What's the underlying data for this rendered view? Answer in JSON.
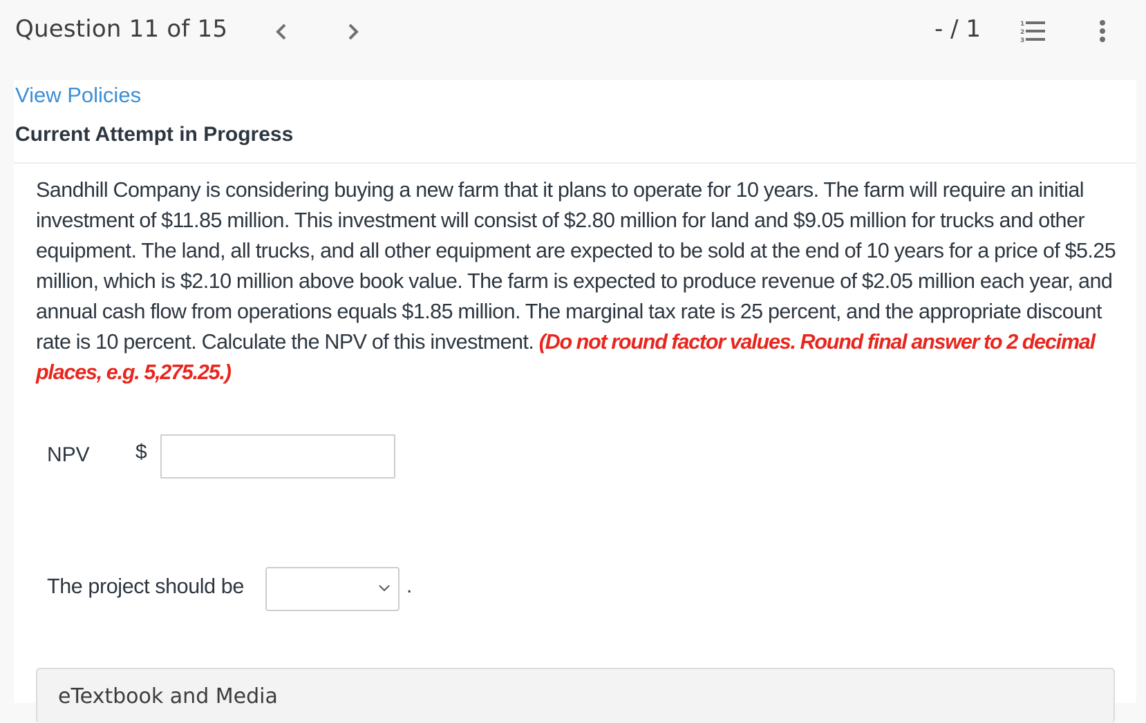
{
  "header": {
    "question_counter": "Question 11 of 15",
    "prev_icon": "chevron-left-icon",
    "next_icon": "chevron-right-icon",
    "score": "- / 1",
    "list_icon": "numbered-list-icon",
    "more_icon": "more-vertical-icon"
  },
  "links": {
    "view_policies": "View Policies"
  },
  "attempt_status": "Current Attempt in Progress",
  "question": {
    "body": "Sandhill Company is considering buying a new farm that it plans to operate for 10 years. The farm will require an initial investment of $11.85 million. This investment will consist of $2.80 million for land and $9.05 million for trucks and other equipment. The land, all trucks, and all other equipment are expected to be sold at the end of 10 years for a price of $5.25 million, which is $2.10 million above book value. The farm is expected to produce revenue of $2.05 million each year, and annual cash flow from operations equals $1.85 million. The marginal tax rate is 25 percent, and the appropriate discount rate is 10 percent. Calculate the NPV of this investment.",
    "instruction": "(Do not round factor values. Round final answer to 2 decimal places, e.g. 5,275.25.)"
  },
  "answers": {
    "npv_label": "NPV",
    "currency_symbol": "$",
    "npv_value": "",
    "project_label": "The project should be",
    "project_selected": "",
    "project_suffix": "."
  },
  "colors": {
    "link": "#3b8fd6",
    "instruction": "#e8261e",
    "text": "#2d3640"
  },
  "etextbook": {
    "title": "eTextbook and Media"
  }
}
